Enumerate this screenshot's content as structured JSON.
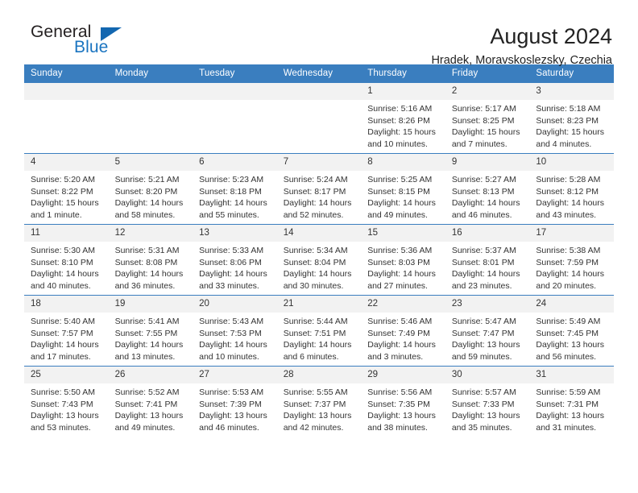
{
  "brand": {
    "name_dark": "General",
    "name_blue": "Blue",
    "accent": "#1a74c0"
  },
  "header": {
    "title": "August 2024",
    "subtitle": "Hradek, Moravskoslezsky, Czechia"
  },
  "calendar": {
    "header_bg": "#3a7ebf",
    "daynum_bg": "#f2f2f2",
    "weekdays": [
      "Sunday",
      "Monday",
      "Tuesday",
      "Wednesday",
      "Thursday",
      "Friday",
      "Saturday"
    ],
    "weeks": [
      [
        {
          "day": ""
        },
        {
          "day": ""
        },
        {
          "day": ""
        },
        {
          "day": ""
        },
        {
          "day": "1",
          "sunrise": "Sunrise: 5:16 AM",
          "sunset": "Sunset: 8:26 PM",
          "daylight1": "Daylight: 15 hours",
          "daylight2": "and 10 minutes."
        },
        {
          "day": "2",
          "sunrise": "Sunrise: 5:17 AM",
          "sunset": "Sunset: 8:25 PM",
          "daylight1": "Daylight: 15 hours",
          "daylight2": "and 7 minutes."
        },
        {
          "day": "3",
          "sunrise": "Sunrise: 5:18 AM",
          "sunset": "Sunset: 8:23 PM",
          "daylight1": "Daylight: 15 hours",
          "daylight2": "and 4 minutes."
        }
      ],
      [
        {
          "day": "4",
          "sunrise": "Sunrise: 5:20 AM",
          "sunset": "Sunset: 8:22 PM",
          "daylight1": "Daylight: 15 hours",
          "daylight2": "and 1 minute."
        },
        {
          "day": "5",
          "sunrise": "Sunrise: 5:21 AM",
          "sunset": "Sunset: 8:20 PM",
          "daylight1": "Daylight: 14 hours",
          "daylight2": "and 58 minutes."
        },
        {
          "day": "6",
          "sunrise": "Sunrise: 5:23 AM",
          "sunset": "Sunset: 8:18 PM",
          "daylight1": "Daylight: 14 hours",
          "daylight2": "and 55 minutes."
        },
        {
          "day": "7",
          "sunrise": "Sunrise: 5:24 AM",
          "sunset": "Sunset: 8:17 PM",
          "daylight1": "Daylight: 14 hours",
          "daylight2": "and 52 minutes."
        },
        {
          "day": "8",
          "sunrise": "Sunrise: 5:25 AM",
          "sunset": "Sunset: 8:15 PM",
          "daylight1": "Daylight: 14 hours",
          "daylight2": "and 49 minutes."
        },
        {
          "day": "9",
          "sunrise": "Sunrise: 5:27 AM",
          "sunset": "Sunset: 8:13 PM",
          "daylight1": "Daylight: 14 hours",
          "daylight2": "and 46 minutes."
        },
        {
          "day": "10",
          "sunrise": "Sunrise: 5:28 AM",
          "sunset": "Sunset: 8:12 PM",
          "daylight1": "Daylight: 14 hours",
          "daylight2": "and 43 minutes."
        }
      ],
      [
        {
          "day": "11",
          "sunrise": "Sunrise: 5:30 AM",
          "sunset": "Sunset: 8:10 PM",
          "daylight1": "Daylight: 14 hours",
          "daylight2": "and 40 minutes."
        },
        {
          "day": "12",
          "sunrise": "Sunrise: 5:31 AM",
          "sunset": "Sunset: 8:08 PM",
          "daylight1": "Daylight: 14 hours",
          "daylight2": "and 36 minutes."
        },
        {
          "day": "13",
          "sunrise": "Sunrise: 5:33 AM",
          "sunset": "Sunset: 8:06 PM",
          "daylight1": "Daylight: 14 hours",
          "daylight2": "and 33 minutes."
        },
        {
          "day": "14",
          "sunrise": "Sunrise: 5:34 AM",
          "sunset": "Sunset: 8:04 PM",
          "daylight1": "Daylight: 14 hours",
          "daylight2": "and 30 minutes."
        },
        {
          "day": "15",
          "sunrise": "Sunrise: 5:36 AM",
          "sunset": "Sunset: 8:03 PM",
          "daylight1": "Daylight: 14 hours",
          "daylight2": "and 27 minutes."
        },
        {
          "day": "16",
          "sunrise": "Sunrise: 5:37 AM",
          "sunset": "Sunset: 8:01 PM",
          "daylight1": "Daylight: 14 hours",
          "daylight2": "and 23 minutes."
        },
        {
          "day": "17",
          "sunrise": "Sunrise: 5:38 AM",
          "sunset": "Sunset: 7:59 PM",
          "daylight1": "Daylight: 14 hours",
          "daylight2": "and 20 minutes."
        }
      ],
      [
        {
          "day": "18",
          "sunrise": "Sunrise: 5:40 AM",
          "sunset": "Sunset: 7:57 PM",
          "daylight1": "Daylight: 14 hours",
          "daylight2": "and 17 minutes."
        },
        {
          "day": "19",
          "sunrise": "Sunrise: 5:41 AM",
          "sunset": "Sunset: 7:55 PM",
          "daylight1": "Daylight: 14 hours",
          "daylight2": "and 13 minutes."
        },
        {
          "day": "20",
          "sunrise": "Sunrise: 5:43 AM",
          "sunset": "Sunset: 7:53 PM",
          "daylight1": "Daylight: 14 hours",
          "daylight2": "and 10 minutes."
        },
        {
          "day": "21",
          "sunrise": "Sunrise: 5:44 AM",
          "sunset": "Sunset: 7:51 PM",
          "daylight1": "Daylight: 14 hours",
          "daylight2": "and 6 minutes."
        },
        {
          "day": "22",
          "sunrise": "Sunrise: 5:46 AM",
          "sunset": "Sunset: 7:49 PM",
          "daylight1": "Daylight: 14 hours",
          "daylight2": "and 3 minutes."
        },
        {
          "day": "23",
          "sunrise": "Sunrise: 5:47 AM",
          "sunset": "Sunset: 7:47 PM",
          "daylight1": "Daylight: 13 hours",
          "daylight2": "and 59 minutes."
        },
        {
          "day": "24",
          "sunrise": "Sunrise: 5:49 AM",
          "sunset": "Sunset: 7:45 PM",
          "daylight1": "Daylight: 13 hours",
          "daylight2": "and 56 minutes."
        }
      ],
      [
        {
          "day": "25",
          "sunrise": "Sunrise: 5:50 AM",
          "sunset": "Sunset: 7:43 PM",
          "daylight1": "Daylight: 13 hours",
          "daylight2": "and 53 minutes."
        },
        {
          "day": "26",
          "sunrise": "Sunrise: 5:52 AM",
          "sunset": "Sunset: 7:41 PM",
          "daylight1": "Daylight: 13 hours",
          "daylight2": "and 49 minutes."
        },
        {
          "day": "27",
          "sunrise": "Sunrise: 5:53 AM",
          "sunset": "Sunset: 7:39 PM",
          "daylight1": "Daylight: 13 hours",
          "daylight2": "and 46 minutes."
        },
        {
          "day": "28",
          "sunrise": "Sunrise: 5:55 AM",
          "sunset": "Sunset: 7:37 PM",
          "daylight1": "Daylight: 13 hours",
          "daylight2": "and 42 minutes."
        },
        {
          "day": "29",
          "sunrise": "Sunrise: 5:56 AM",
          "sunset": "Sunset: 7:35 PM",
          "daylight1": "Daylight: 13 hours",
          "daylight2": "and 38 minutes."
        },
        {
          "day": "30",
          "sunrise": "Sunrise: 5:57 AM",
          "sunset": "Sunset: 7:33 PM",
          "daylight1": "Daylight: 13 hours",
          "daylight2": "and 35 minutes."
        },
        {
          "day": "31",
          "sunrise": "Sunrise: 5:59 AM",
          "sunset": "Sunset: 7:31 PM",
          "daylight1": "Daylight: 13 hours",
          "daylight2": "and 31 minutes."
        }
      ]
    ]
  }
}
